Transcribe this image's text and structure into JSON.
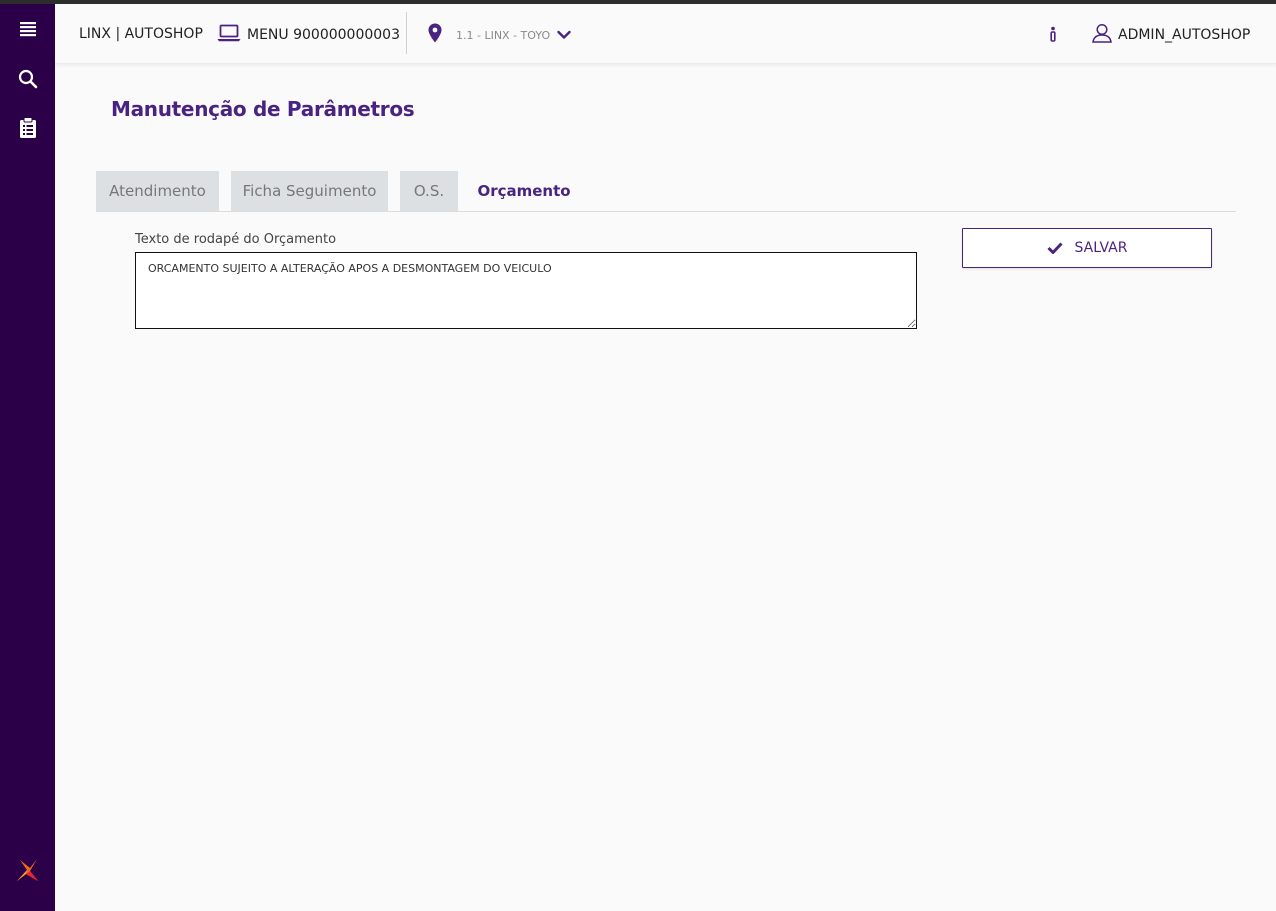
{
  "colors": {
    "sidebar": "#2c0049",
    "accent": "#4a2380",
    "tab_bg": "#dde0e3"
  },
  "sidebar": {
    "items": [
      {
        "icon": "menu-list-icon"
      },
      {
        "icon": "search-icon"
      },
      {
        "icon": "clipboard-icon"
      }
    ],
    "logo_icon": "linx-logo-icon"
  },
  "header": {
    "brand": "LINX | AUTOSHOP",
    "menu_label": "MENU 900000000003",
    "store_label": "1.1 - LINX - TOYO",
    "user_label": "ADMIN_AUTOSHOP"
  },
  "page": {
    "title": "Manutenção de Parâmetros",
    "tabs": [
      {
        "label": "Atendimento",
        "active": false
      },
      {
        "label": "Ficha Seguimento",
        "active": false
      },
      {
        "label": "O.S.",
        "active": false
      },
      {
        "label": "Orçamento",
        "active": true
      }
    ],
    "footer_field": {
      "label": "Texto de rodapé do Orçamento",
      "value": "ORCAMENTO SUJEITO A ALTERAÇÃO APOS A DESMONTAGEM DO VEICULO"
    },
    "save_label": "SALVAR"
  }
}
